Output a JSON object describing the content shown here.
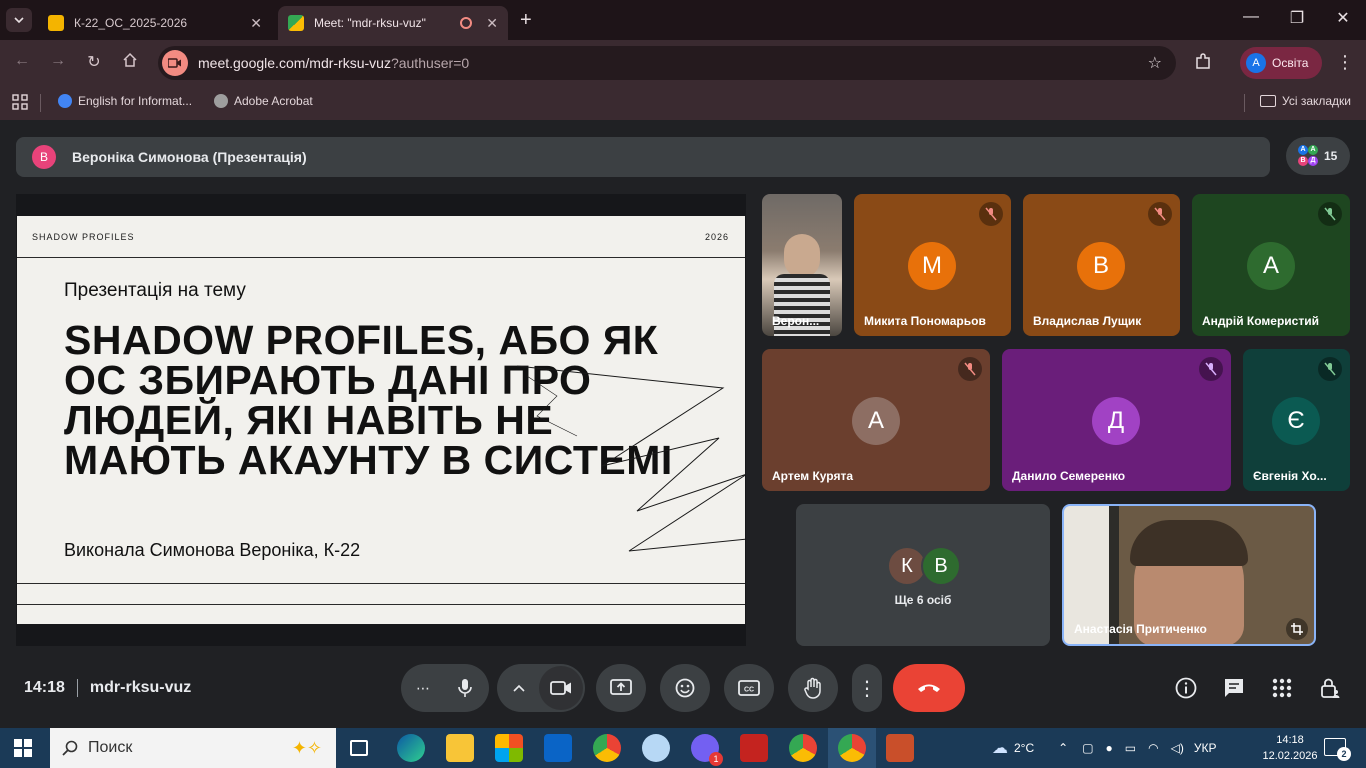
{
  "browser": {
    "tabs": [
      {
        "label": "К-22_ОС_2025-2026",
        "active": false
      },
      {
        "label": "Meet: \"mdr-rksu-vuz\"",
        "active": true
      }
    ],
    "url_main": "meet.google.com/mdr-rksu-vuz",
    "url_query": "?authuser=0",
    "profile": {
      "initial": "A",
      "label": "Освіта"
    },
    "bookmarks": [
      {
        "label": "English for Informat..."
      },
      {
        "label": "Adobe Acrobat"
      }
    ],
    "all_bookmarks": "Усі закладки"
  },
  "meet": {
    "presenter": {
      "initial": "В",
      "label": "Вероніка Симонова (Презентація)"
    },
    "participant_count": "15",
    "slide": {
      "header_left": "SHADOW PROFILES",
      "header_right": "2026",
      "subtitle": "Презентація на тему",
      "title": "SHADOW PROFILES, АБО ЯК ОС ЗБИРАЮТЬ ДАНІ ПРО ЛЮДЕЙ, ЯКІ НАВІТЬ НЕ МАЮТЬ АКАУНТУ В СИСТЕМІ",
      "author": "Виконала Симонова Вероніка, К-22"
    },
    "tiles": [
      {
        "name": "Верон...",
        "initial": ""
      },
      {
        "name": "Микита Пономарьов",
        "initial": "М"
      },
      {
        "name": "Владислав Лущик",
        "initial": "В"
      },
      {
        "name": "Андрій Комеристий",
        "initial": "А"
      },
      {
        "name": "Артем Курята",
        "initial": "А"
      },
      {
        "name": "Данило Семеренко",
        "initial": "Д"
      },
      {
        "name": "Євгенія Хо...",
        "initial": "Є"
      }
    ],
    "others": {
      "avatars": [
        "К",
        "В"
      ],
      "label": "Ще 6 осіб"
    },
    "self": {
      "name": "Анастасія Притиченко"
    },
    "time": "14:18",
    "code": "mdr-rksu-vuz",
    "more_label": "⋯"
  },
  "taskbar": {
    "search_placeholder": "Поиск",
    "weather": "2°C",
    "language": "УКР",
    "time": "14:18",
    "date": "12.02.2026",
    "notifications": "2",
    "viber_badge": "1"
  }
}
